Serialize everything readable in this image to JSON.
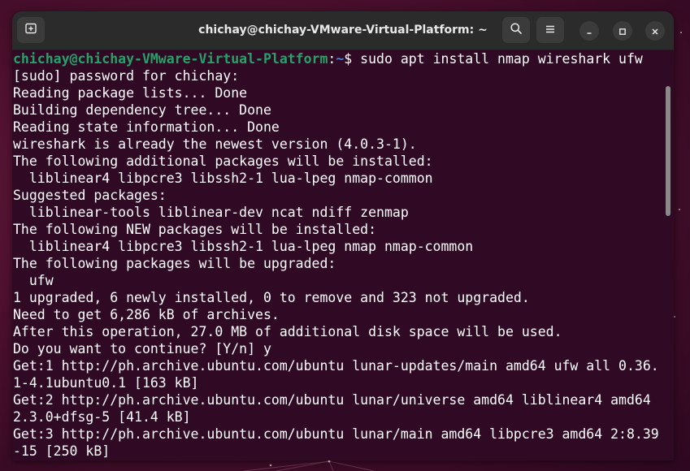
{
  "window": {
    "title": "chichay@chichay-VMware-Virtual-Platform: ~"
  },
  "icons": {
    "new_tab": "new-tab-icon",
    "search": "search-icon",
    "menu": "hamburger-menu-icon",
    "minimize": "minimize-icon",
    "maximize": "maximize-icon",
    "close": "close-icon"
  },
  "colors": {
    "terminal_bg": "#300a24",
    "prompt_user": "#26a269",
    "prompt_path": "#4a7fd0",
    "text": "#ffffff"
  },
  "terminal": {
    "prompt": {
      "user_host": "chichay@chichay-VMware-Virtual-Platform",
      "separator": ":",
      "path": "~",
      "symbol": "$ ",
      "command": "sudo apt install nmap wireshark ufw"
    },
    "lines": [
      "[sudo] password for chichay:",
      "Reading package lists... Done",
      "Building dependency tree... Done",
      "Reading state information... Done",
      "wireshark is already the newest version (4.0.3-1).",
      "The following additional packages will be installed:",
      "  liblinear4 libpcre3 libssh2-1 lua-lpeg nmap-common",
      "Suggested packages:",
      "  liblinear-tools liblinear-dev ncat ndiff zenmap",
      "The following NEW packages will be installed:",
      "  liblinear4 libpcre3 libssh2-1 lua-lpeg nmap nmap-common",
      "The following packages will be upgraded:",
      "  ufw",
      "1 upgraded, 6 newly installed, 0 to remove and 323 not upgraded.",
      "Need to get 6,286 kB of archives.",
      "After this operation, 27.0 MB of additional disk space will be used.",
      "Do you want to continue? [Y/n] y",
      "Get:1 http://ph.archive.ubuntu.com/ubuntu lunar-updates/main amd64 ufw all 0.36.",
      "1-4.1ubuntu0.1 [163 kB]",
      "Get:2 http://ph.archive.ubuntu.com/ubuntu lunar/universe amd64 liblinear4 amd64",
      "2.3.0+dfsg-5 [41.4 kB]",
      "Get:3 http://ph.archive.ubuntu.com/ubuntu lunar/main amd64 libpcre3 amd64 2:8.39",
      "-15 [250 kB]"
    ]
  }
}
